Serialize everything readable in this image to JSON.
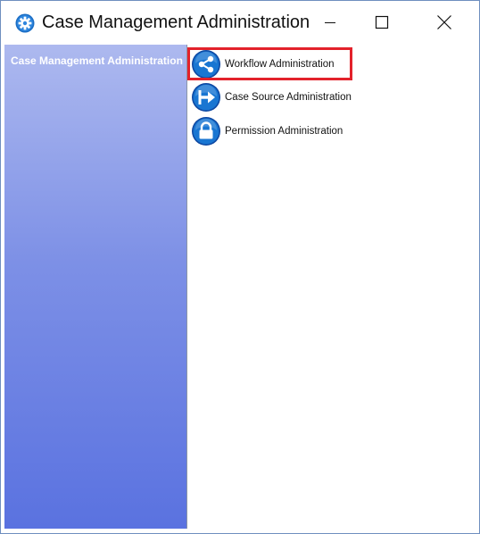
{
  "window": {
    "title": "Case Management Administration",
    "app_icon": "gear-icon",
    "controls": {
      "minimize": "minimize-icon",
      "maximize": "maximize-icon",
      "close": "close-icon"
    }
  },
  "sidebar": {
    "title": "Case Management Administration"
  },
  "items": [
    {
      "label": "Workflow Administration",
      "icon": "share-nodes-icon",
      "highlighted": true
    },
    {
      "label": "Case Source Administration",
      "icon": "arrow-exit-icon",
      "highlighted": false
    },
    {
      "label": "Permission Administration",
      "icon": "lock-icon",
      "highlighted": false
    }
  ],
  "colors": {
    "highlight_border": "#e3222b",
    "sidebar_gradient_top": "#adb9ef",
    "sidebar_gradient_bottom": "#5a72e0",
    "icon_blue": "#1565c0"
  }
}
